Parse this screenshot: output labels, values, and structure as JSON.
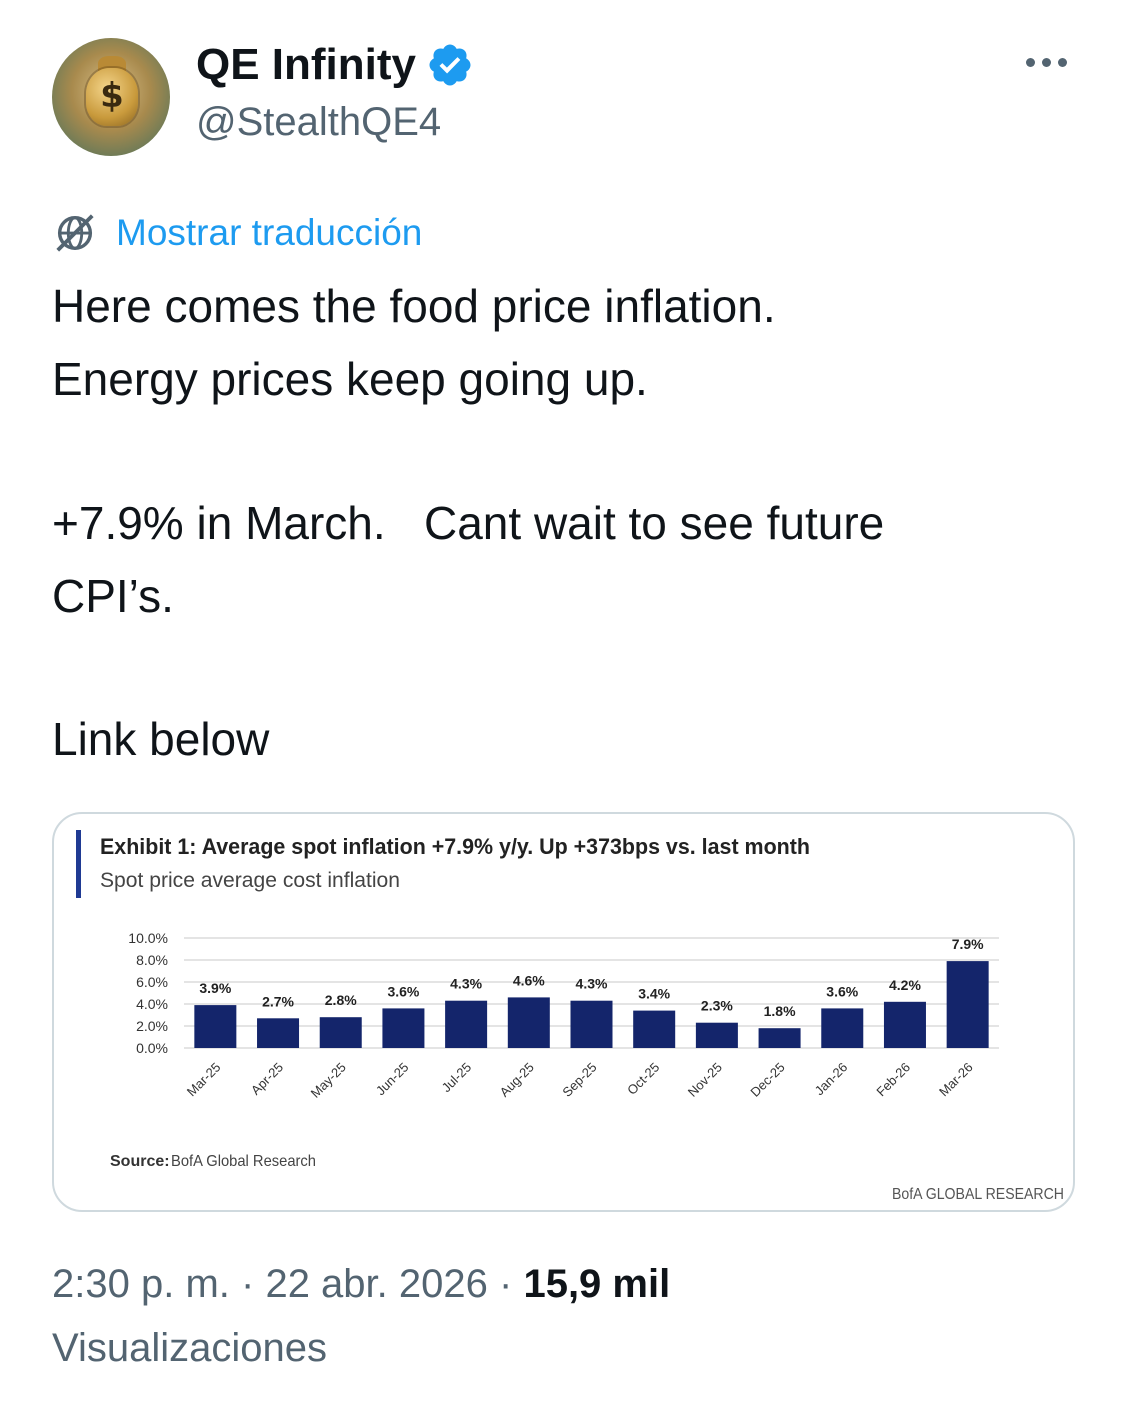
{
  "author": {
    "name": "QE Infinity",
    "handle": "@StealthQE4",
    "avatar_icon": "money-bag-icon",
    "verified_icon": "verified-badge-icon"
  },
  "translate": {
    "label": "Mostrar traducción",
    "icon": "globe-slash-icon"
  },
  "tweet": {
    "line1": "Here comes the food price inflation.",
    "line2": "Energy prices keep going up.",
    "line3": "+7.9% in March.   Cant wait to see future",
    "line4": "CPI’s.",
    "line5": "Link below"
  },
  "chart_card": {
    "title": "Exhibit 1: Average spot inflation +7.9% y/y. Up +373bps vs. last month",
    "subtitle": "Spot price average cost inflation",
    "source_label": "Source:",
    "source_text": "BofA Global Research",
    "watermark": "BofA GLOBAL RESEARCH"
  },
  "chart_data": {
    "type": "bar",
    "title": "Exhibit 1: Average spot inflation +7.9% y/y. Up +373bps vs. last month",
    "subtitle": "Spot price average cost inflation",
    "categories": [
      "Mar-25",
      "Apr-25",
      "May-25",
      "Jun-25",
      "Jul-25",
      "Aug-25",
      "Sep-25",
      "Oct-25",
      "Nov-25",
      "Dec-25",
      "Jan-26",
      "Feb-26",
      "Mar-26"
    ],
    "values": [
      3.9,
      2.7,
      2.8,
      3.6,
      4.3,
      4.6,
      4.3,
      3.4,
      2.3,
      1.8,
      3.6,
      4.2,
      7.9
    ],
    "data_labels": [
      "3.9%",
      "2.7%",
      "2.8%",
      "3.6%",
      "4.3%",
      "4.6%",
      "4.3%",
      "3.4%",
      "2.3%",
      "1.8%",
      "3.6%",
      "4.2%",
      "7.9%"
    ],
    "yticks": [
      "0.0%",
      "2.0%",
      "4.0%",
      "6.0%",
      "8.0%",
      "10.0%"
    ],
    "ylim": [
      0,
      10
    ],
    "grid": true,
    "bar_color": "#14256b"
  },
  "footer": {
    "time": "2:30 p. m.",
    "separator": "·",
    "date": "22 abr. 2026",
    "views_count": "15,9 mil",
    "views_label": "Visualizaciones"
  }
}
